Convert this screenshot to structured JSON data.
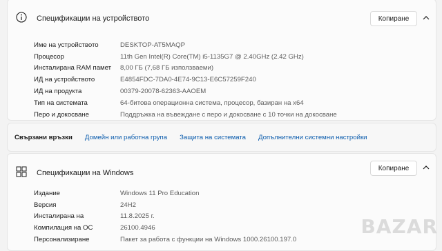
{
  "device_specs": {
    "title": "Спецификации на устройството",
    "copy_label": "Копиране",
    "rows": [
      {
        "label": "Име на устройството",
        "value": "DESKTOP-AT5MAQP"
      },
      {
        "label": "Процесор",
        "value": "11th Gen Intel(R) Core(TM) i5-1135G7 @ 2.40GHz (2.42 GHz)"
      },
      {
        "label": "Инсталирана RAM памет",
        "value": "8,00 ГБ (7,68 ГБ използваеми)"
      },
      {
        "label": "ИД на устройството",
        "value": "E4854FDC-7DA0-4E74-9C13-E6C57259F240"
      },
      {
        "label": "ИД на продукта",
        "value": "00379-20078-62363-AAOEM"
      },
      {
        "label": "Тип на системата",
        "value": "64-битова операционна система, процесор, базиран на x64"
      },
      {
        "label": "Перо и докосване",
        "value": "Поддръжка на въвеждане с перо и докосване с 10 точки на докосване"
      }
    ]
  },
  "related_links": {
    "title": "Свързани връзки",
    "links": [
      "Домейн или работна група",
      "Защита на системата",
      "Допълнителни системни настройки"
    ]
  },
  "windows_specs": {
    "title": "Спецификации на Windows",
    "copy_label": "Копиране",
    "rows": [
      {
        "label": "Издание",
        "value": "Windows 11 Pro Education"
      },
      {
        "label": "Версия",
        "value": "24H2"
      },
      {
        "label": "Инсталирана на",
        "value": "11.8.2025 г."
      },
      {
        "label": "Компилация на ОС",
        "value": "26100.4946"
      },
      {
        "label": "Персонализиране",
        "value": "Пакет за работа с функции на Windows 1000.26100.197.0"
      }
    ]
  },
  "icons": {
    "info": "info-icon",
    "windows": "windows-logo-icon",
    "chevron": "chevron-up-icon"
  },
  "colors": {
    "link": "#0b5cad",
    "accent": "#1b1b1b"
  },
  "watermark": "BAZAR"
}
